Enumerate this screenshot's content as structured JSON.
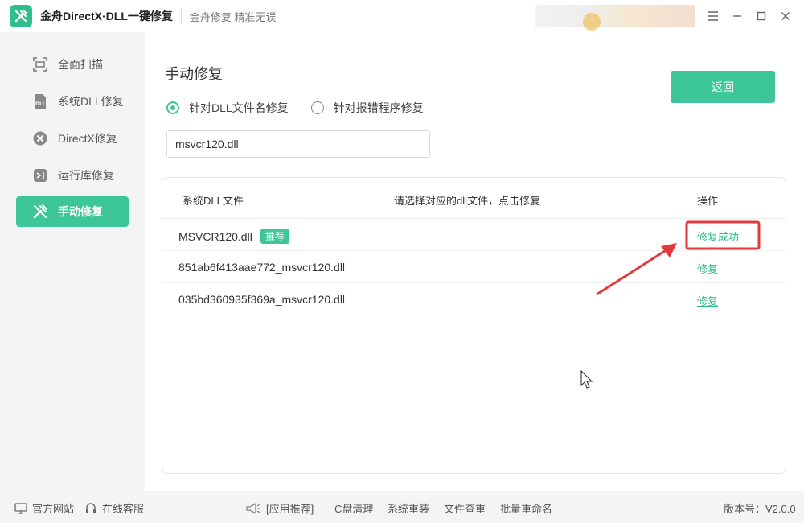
{
  "app": {
    "title": "金舟DirectX·DLL一键修复",
    "slogan": "金舟修复 精准无误"
  },
  "sidebar": {
    "items": [
      {
        "label": "全面扫描",
        "icon": "scan-icon",
        "active": false
      },
      {
        "label": "系统DLL修复",
        "icon": "dll-icon",
        "active": false
      },
      {
        "label": "DirectX修复",
        "icon": "directx-icon",
        "active": false
      },
      {
        "label": "运行库修复",
        "icon": "runtime-icon",
        "active": false
      },
      {
        "label": "手动修复",
        "icon": "wrench-icon",
        "active": true
      }
    ]
  },
  "main": {
    "title": "手动修复",
    "back_label": "返回",
    "radios": [
      {
        "label": "针对DLL文件名修复",
        "checked": true
      },
      {
        "label": "针对报错程序修复",
        "checked": false
      }
    ],
    "search_value": "msvcr120.dll",
    "table": {
      "headers": [
        "系统DLL文件",
        "请选择对应的dll文件，点击修复",
        "操作"
      ],
      "rows": [
        {
          "file": "MSVCR120.dll",
          "badge": "推荐",
          "action": "修复成功"
        },
        {
          "file": "851ab6f413aae772_msvcr120.dll",
          "badge": "",
          "action": "修复"
        },
        {
          "file": "035bd360935f369a_msvcr120.dll",
          "badge": "",
          "action": "修复"
        }
      ]
    }
  },
  "footer": {
    "website": "官方网站",
    "support": "在线客服",
    "recommend": "[应用推荐]",
    "links": [
      "C盘清理",
      "系统重装",
      "文件查重",
      "批量重命名"
    ],
    "version": "版本号：V2.0.0"
  },
  "colors": {
    "accent": "#3dc798",
    "annotation": "#e03a3a"
  }
}
